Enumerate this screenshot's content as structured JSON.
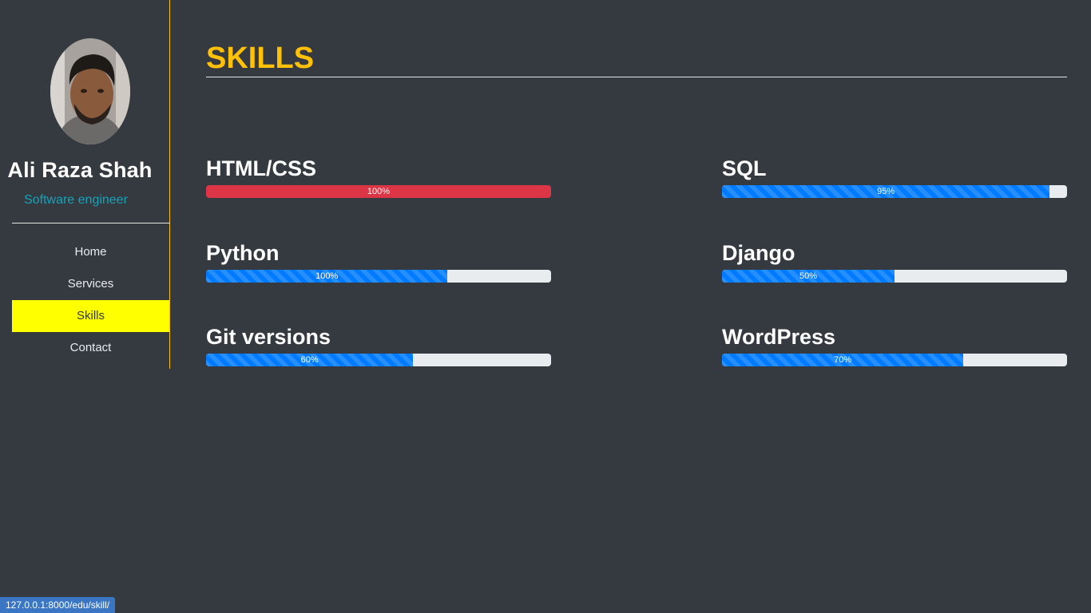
{
  "profile": {
    "name": "Ali Raza Shah",
    "role": "Software engineer"
  },
  "nav": {
    "items": [
      {
        "label": "Home",
        "active": false
      },
      {
        "label": "Services",
        "active": false
      },
      {
        "label": "Skills",
        "active": true
      },
      {
        "label": "Contact",
        "active": false
      }
    ]
  },
  "main": {
    "title": "SKILLS"
  },
  "skills": [
    {
      "label": "HTML/CSS",
      "text": "100%",
      "fill": 1.0,
      "color": "#dc3545",
      "striped": false
    },
    {
      "label": "SQL",
      "text": "95%",
      "fill": 0.95,
      "color": "#007bff",
      "striped": true
    },
    {
      "label": "Python",
      "text": "100%",
      "fill": 0.7,
      "color": "#007bff",
      "striped": true
    },
    {
      "label": "Django",
      "text": "50%",
      "fill": 0.5,
      "color": "#007bff",
      "striped": true
    },
    {
      "label": "Git versions",
      "text": "60%",
      "fill": 0.6,
      "color": "#007bff",
      "striped": true
    },
    {
      "label": "WordPress",
      "text": "70%",
      "fill": 0.7,
      "color": "#007bff",
      "striped": true
    }
  ],
  "status_bar": {
    "url": "127.0.0.1:8000/edu/skill/"
  },
  "colors": {
    "accent": "#ffc107",
    "active_nav": "#ffff00",
    "role": "#17a2b8",
    "background": "#343a40"
  }
}
